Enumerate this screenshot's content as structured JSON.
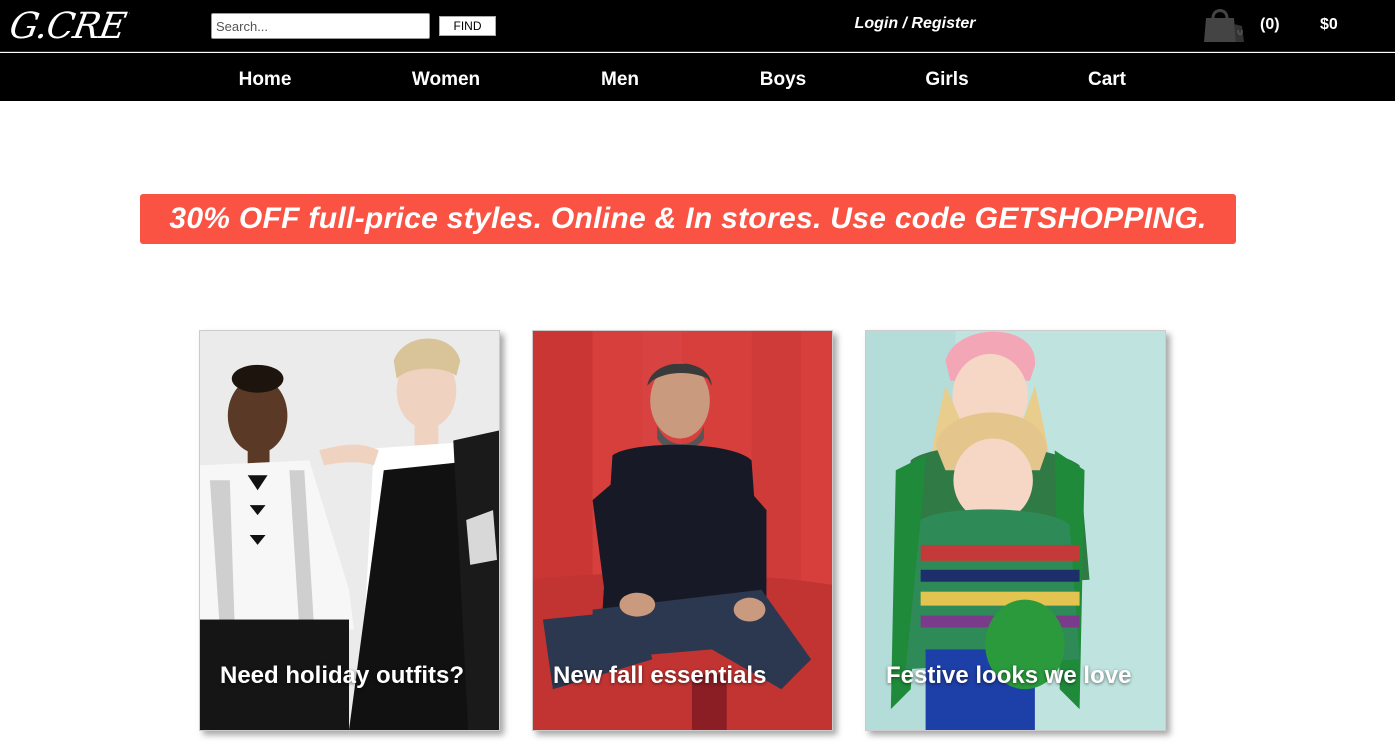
{
  "header": {
    "logo_text": "G.CREW",
    "search_placeholder": "Search...",
    "find_label": "FIND",
    "login_label": "Login / Register",
    "cart_count": "(0)",
    "cart_total": "$0"
  },
  "nav": {
    "items": [
      "Home",
      "Women",
      "Men",
      "Boys",
      "Girls",
      "Cart"
    ]
  },
  "promo": {
    "text": "30% OFF full-price styles. Online & In stores. Use code GETSHOPPING.",
    "color": "#fa5344"
  },
  "cards": [
    {
      "caption": "Need holiday outfits?"
    },
    {
      "caption": "New fall essentials"
    },
    {
      "caption": "Festive looks we love"
    }
  ],
  "icons": {
    "cart": "shopping-bag-icon"
  }
}
